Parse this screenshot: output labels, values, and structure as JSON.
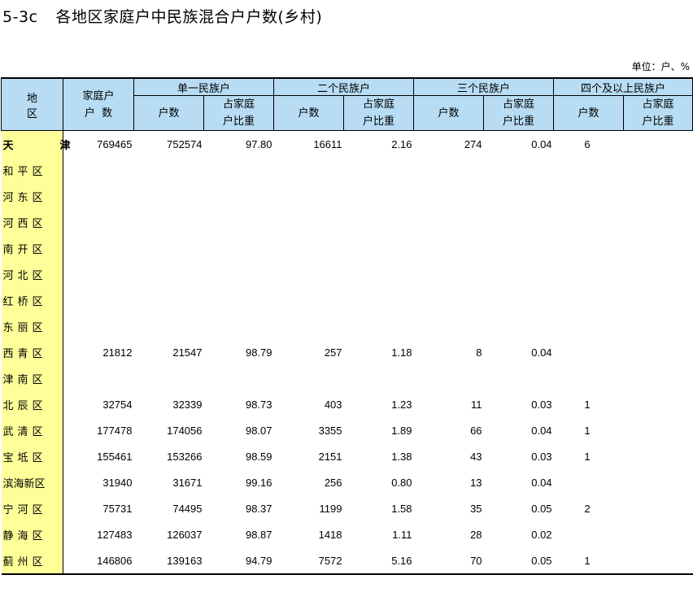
{
  "title": {
    "code": "5-3c",
    "text": "各地区家庭户中民族混合户户数(乡村)"
  },
  "unit": "单位：户、%",
  "headers": {
    "region": "地 区",
    "households_line1": "家庭户",
    "households_line2": "户  数",
    "groups": [
      "单一民族户",
      "二个民族户",
      "三个民族户",
      "四个及以上民族户"
    ],
    "count": "户数",
    "share_line1": "占家庭",
    "share_line2": "户比重"
  },
  "rows": [
    {
      "region": "天　津",
      "total": "769465",
      "s1": "752574",
      "p1": "97.80",
      "s2": "16611",
      "p2": "2.16",
      "s3": "274",
      "p3": "0.04",
      "s4": "6",
      "p4": ""
    },
    {
      "region": "和平区",
      "total": "",
      "s1": "",
      "p1": "",
      "s2": "",
      "p2": "",
      "s3": "",
      "p3": "",
      "s4": "",
      "p4": ""
    },
    {
      "region": "河东区",
      "total": "",
      "s1": "",
      "p1": "",
      "s2": "",
      "p2": "",
      "s3": "",
      "p3": "",
      "s4": "",
      "p4": ""
    },
    {
      "region": "河西区",
      "total": "",
      "s1": "",
      "p1": "",
      "s2": "",
      "p2": "",
      "s3": "",
      "p3": "",
      "s4": "",
      "p4": ""
    },
    {
      "region": "南开区",
      "total": "",
      "s1": "",
      "p1": "",
      "s2": "",
      "p2": "",
      "s3": "",
      "p3": "",
      "s4": "",
      "p4": ""
    },
    {
      "region": "河北区",
      "total": "",
      "s1": "",
      "p1": "",
      "s2": "",
      "p2": "",
      "s3": "",
      "p3": "",
      "s4": "",
      "p4": ""
    },
    {
      "region": "红桥区",
      "total": "",
      "s1": "",
      "p1": "",
      "s2": "",
      "p2": "",
      "s3": "",
      "p3": "",
      "s4": "",
      "p4": ""
    },
    {
      "region": "东丽区",
      "total": "",
      "s1": "",
      "p1": "",
      "s2": "",
      "p2": "",
      "s3": "",
      "p3": "",
      "s4": "",
      "p4": ""
    },
    {
      "region": "西青区",
      "total": "21812",
      "s1": "21547",
      "p1": "98.79",
      "s2": "257",
      "p2": "1.18",
      "s3": "8",
      "p3": "0.04",
      "s4": "",
      "p4": ""
    },
    {
      "region": "津南区",
      "total": "",
      "s1": "",
      "p1": "",
      "s2": "",
      "p2": "",
      "s3": "",
      "p3": "",
      "s4": "",
      "p4": ""
    },
    {
      "region": "北辰区",
      "total": "32754",
      "s1": "32339",
      "p1": "98.73",
      "s2": "403",
      "p2": "1.23",
      "s3": "11",
      "p3": "0.03",
      "s4": "1",
      "p4": ""
    },
    {
      "region": "武清区",
      "total": "177478",
      "s1": "174056",
      "p1": "98.07",
      "s2": "3355",
      "p2": "1.89",
      "s3": "66",
      "p3": "0.04",
      "s4": "1",
      "p4": ""
    },
    {
      "region": "宝坻区",
      "total": "155461",
      "s1": "153266",
      "p1": "98.59",
      "s2": "2151",
      "p2": "1.38",
      "s3": "43",
      "p3": "0.03",
      "s4": "1",
      "p4": ""
    },
    {
      "region": "滨海新区",
      "total": "31940",
      "s1": "31671",
      "p1": "99.16",
      "s2": "256",
      "p2": "0.80",
      "s3": "13",
      "p3": "0.04",
      "s4": "",
      "p4": ""
    },
    {
      "region": "宁河区",
      "total": "75731",
      "s1": "74495",
      "p1": "98.37",
      "s2": "1199",
      "p2": "1.58",
      "s3": "35",
      "p3": "0.05",
      "s4": "2",
      "p4": ""
    },
    {
      "region": "静海区",
      "total": "127483",
      "s1": "126037",
      "p1": "98.87",
      "s2": "1418",
      "p2": "1.11",
      "s3": "28",
      "p3": "0.02",
      "s4": "",
      "p4": ""
    },
    {
      "region": "蓟州区",
      "total": "146806",
      "s1": "139163",
      "p1": "94.79",
      "s2": "7572",
      "p2": "5.16",
      "s3": "70",
      "p3": "0.05",
      "s4": "1",
      "p4": ""
    }
  ],
  "colors": {
    "header_bg": "#b7dcf3",
    "region_bg": "#ffff99"
  }
}
